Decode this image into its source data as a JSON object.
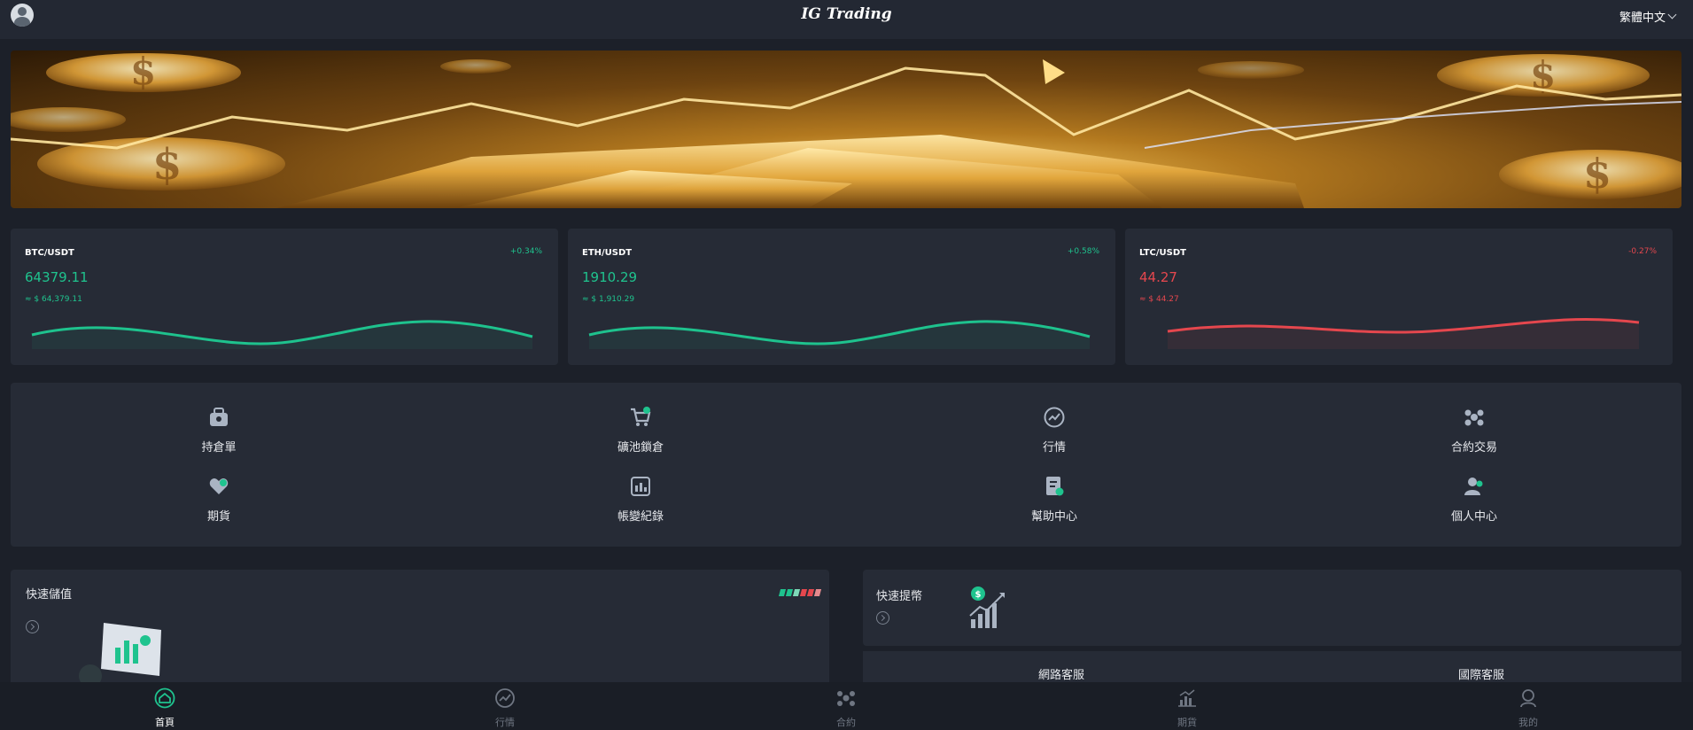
{
  "header": {
    "title": "IG Trading",
    "language": "繁體中文"
  },
  "tickers": [
    {
      "pair": "BTC/USDT",
      "change": "+0.34%",
      "price": "64379.11",
      "usd": "≈ $ 64,379.11",
      "trend": "up"
    },
    {
      "pair": "ETH/USDT",
      "change": "+0.58%",
      "price": "1910.29",
      "usd": "≈ $ 1,910.29",
      "trend": "up"
    },
    {
      "pair": "LTC/USDT",
      "change": "-0.27%",
      "price": "44.27",
      "usd": "≈ $ 44.27",
      "trend": "down"
    }
  ],
  "menu": {
    "items": [
      {
        "label": "持倉單",
        "icon": "position-icon"
      },
      {
        "label": "礦池鎖倉",
        "icon": "cart-icon"
      },
      {
        "label": "行情",
        "icon": "trend-icon"
      },
      {
        "label": "合約交易",
        "icon": "contract-icon"
      },
      {
        "label": "期貨",
        "icon": "futures-icon"
      },
      {
        "label": "帳變紀錄",
        "icon": "record-icon"
      },
      {
        "label": "幫助中心",
        "icon": "help-icon"
      },
      {
        "label": "個人中心",
        "icon": "user-icon"
      }
    ]
  },
  "cards": {
    "deposit": "快速儲值",
    "withdraw": "快速提幣",
    "online_service": "網路客服",
    "intl_service": "國際客服"
  },
  "tabbar": {
    "items": [
      {
        "label": "首頁",
        "icon": "home-icon",
        "active": true
      },
      {
        "label": "行情",
        "icon": "trend-icon",
        "active": false
      },
      {
        "label": "合約",
        "icon": "contract-icon",
        "active": false
      },
      {
        "label": "期貨",
        "icon": "futures-icon",
        "active": false
      },
      {
        "label": "我的",
        "icon": "user-icon",
        "active": false
      }
    ]
  },
  "colors": {
    "up": "#1fc38e",
    "down": "#e5474e",
    "background": "#1c2029",
    "card": "#262b36"
  }
}
